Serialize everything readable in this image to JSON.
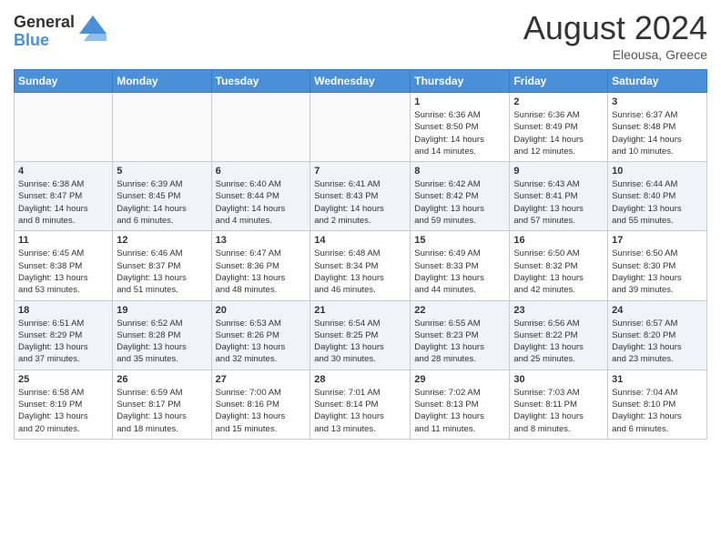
{
  "header": {
    "logo_general": "General",
    "logo_blue": "Blue",
    "month_title": "August 2024",
    "location": "Eleousa, Greece"
  },
  "weekdays": [
    "Sunday",
    "Monday",
    "Tuesday",
    "Wednesday",
    "Thursday",
    "Friday",
    "Saturday"
  ],
  "weeks": [
    [
      {
        "day": "",
        "info": ""
      },
      {
        "day": "",
        "info": ""
      },
      {
        "day": "",
        "info": ""
      },
      {
        "day": "",
        "info": ""
      },
      {
        "day": "1",
        "info": "Sunrise: 6:36 AM\nSunset: 8:50 PM\nDaylight: 14 hours\nand 14 minutes."
      },
      {
        "day": "2",
        "info": "Sunrise: 6:36 AM\nSunset: 8:49 PM\nDaylight: 14 hours\nand 12 minutes."
      },
      {
        "day": "3",
        "info": "Sunrise: 6:37 AM\nSunset: 8:48 PM\nDaylight: 14 hours\nand 10 minutes."
      }
    ],
    [
      {
        "day": "4",
        "info": "Sunrise: 6:38 AM\nSunset: 8:47 PM\nDaylight: 14 hours\nand 8 minutes."
      },
      {
        "day": "5",
        "info": "Sunrise: 6:39 AM\nSunset: 8:45 PM\nDaylight: 14 hours\nand 6 minutes."
      },
      {
        "day": "6",
        "info": "Sunrise: 6:40 AM\nSunset: 8:44 PM\nDaylight: 14 hours\nand 4 minutes."
      },
      {
        "day": "7",
        "info": "Sunrise: 6:41 AM\nSunset: 8:43 PM\nDaylight: 14 hours\nand 2 minutes."
      },
      {
        "day": "8",
        "info": "Sunrise: 6:42 AM\nSunset: 8:42 PM\nDaylight: 13 hours\nand 59 minutes."
      },
      {
        "day": "9",
        "info": "Sunrise: 6:43 AM\nSunset: 8:41 PM\nDaylight: 13 hours\nand 57 minutes."
      },
      {
        "day": "10",
        "info": "Sunrise: 6:44 AM\nSunset: 8:40 PM\nDaylight: 13 hours\nand 55 minutes."
      }
    ],
    [
      {
        "day": "11",
        "info": "Sunrise: 6:45 AM\nSunset: 8:38 PM\nDaylight: 13 hours\nand 53 minutes."
      },
      {
        "day": "12",
        "info": "Sunrise: 6:46 AM\nSunset: 8:37 PM\nDaylight: 13 hours\nand 51 minutes."
      },
      {
        "day": "13",
        "info": "Sunrise: 6:47 AM\nSunset: 8:36 PM\nDaylight: 13 hours\nand 48 minutes."
      },
      {
        "day": "14",
        "info": "Sunrise: 6:48 AM\nSunset: 8:34 PM\nDaylight: 13 hours\nand 46 minutes."
      },
      {
        "day": "15",
        "info": "Sunrise: 6:49 AM\nSunset: 8:33 PM\nDaylight: 13 hours\nand 44 minutes."
      },
      {
        "day": "16",
        "info": "Sunrise: 6:50 AM\nSunset: 8:32 PM\nDaylight: 13 hours\nand 42 minutes."
      },
      {
        "day": "17",
        "info": "Sunrise: 6:50 AM\nSunset: 8:30 PM\nDaylight: 13 hours\nand 39 minutes."
      }
    ],
    [
      {
        "day": "18",
        "info": "Sunrise: 6:51 AM\nSunset: 8:29 PM\nDaylight: 13 hours\nand 37 minutes."
      },
      {
        "day": "19",
        "info": "Sunrise: 6:52 AM\nSunset: 8:28 PM\nDaylight: 13 hours\nand 35 minutes."
      },
      {
        "day": "20",
        "info": "Sunrise: 6:53 AM\nSunset: 8:26 PM\nDaylight: 13 hours\nand 32 minutes."
      },
      {
        "day": "21",
        "info": "Sunrise: 6:54 AM\nSunset: 8:25 PM\nDaylight: 13 hours\nand 30 minutes."
      },
      {
        "day": "22",
        "info": "Sunrise: 6:55 AM\nSunset: 8:23 PM\nDaylight: 13 hours\nand 28 minutes."
      },
      {
        "day": "23",
        "info": "Sunrise: 6:56 AM\nSunset: 8:22 PM\nDaylight: 13 hours\nand 25 minutes."
      },
      {
        "day": "24",
        "info": "Sunrise: 6:57 AM\nSunset: 8:20 PM\nDaylight: 13 hours\nand 23 minutes."
      }
    ],
    [
      {
        "day": "25",
        "info": "Sunrise: 6:58 AM\nSunset: 8:19 PM\nDaylight: 13 hours\nand 20 minutes."
      },
      {
        "day": "26",
        "info": "Sunrise: 6:59 AM\nSunset: 8:17 PM\nDaylight: 13 hours\nand 18 minutes."
      },
      {
        "day": "27",
        "info": "Sunrise: 7:00 AM\nSunset: 8:16 PM\nDaylight: 13 hours\nand 15 minutes."
      },
      {
        "day": "28",
        "info": "Sunrise: 7:01 AM\nSunset: 8:14 PM\nDaylight: 13 hours\nand 13 minutes."
      },
      {
        "day": "29",
        "info": "Sunrise: 7:02 AM\nSunset: 8:13 PM\nDaylight: 13 hours\nand 11 minutes."
      },
      {
        "day": "30",
        "info": "Sunrise: 7:03 AM\nSunset: 8:11 PM\nDaylight: 13 hours\nand 8 minutes."
      },
      {
        "day": "31",
        "info": "Sunrise: 7:04 AM\nSunset: 8:10 PM\nDaylight: 13 hours\nand 6 minutes."
      }
    ]
  ]
}
